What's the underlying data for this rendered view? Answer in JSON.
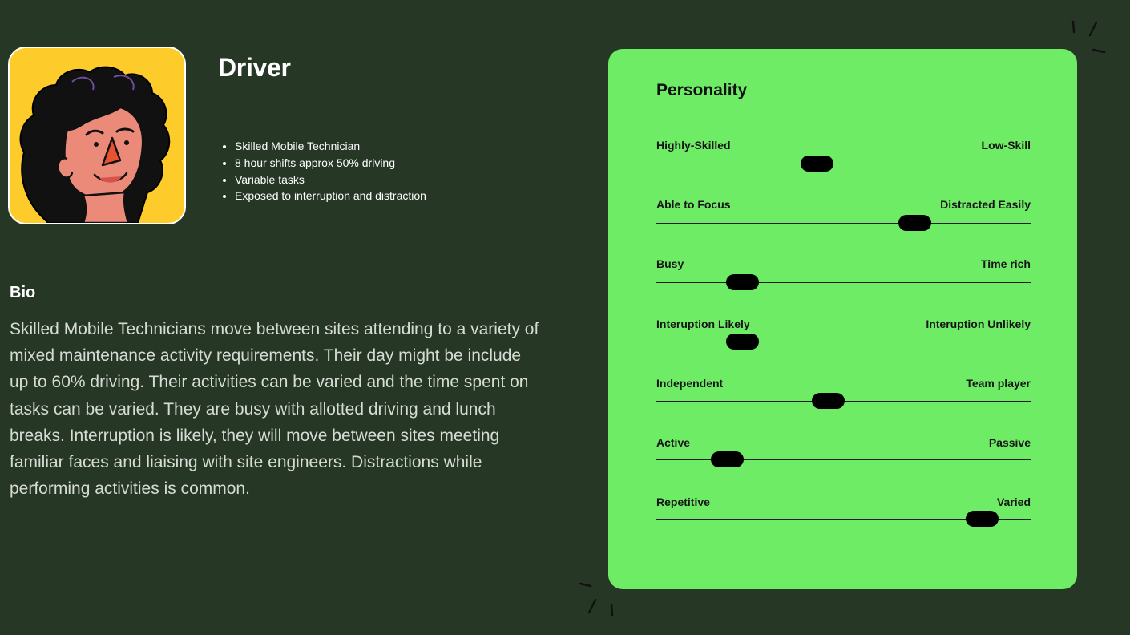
{
  "persona": {
    "title": "Driver",
    "facts": [
      "Skilled Mobile Technician",
      "8 hour shifts approx 50% driving",
      "Variable tasks",
      "Exposed to interruption and distraction"
    ],
    "avatar_icon": "illustrated-face-avatar"
  },
  "bio": {
    "heading": "Bio",
    "text": "Skilled Mobile Technicians move between sites attending to a variety of mixed maintenance activity requirements. Their day might be include up to 60% driving. Their activities can be varied and the time spent on tasks can be varied. They are busy with allotted driving and lunch breaks. Interruption is likely, they will move between sites meeting familiar faces and liaising with site engineers. Distractions while performing activities is common."
  },
  "personality": {
    "title": "Personality",
    "traits": [
      {
        "left": "Highly-Skilled",
        "right": "Low-Skill",
        "value": 0.43
      },
      {
        "left": "Able to Focus",
        "right": "Distracted Easily",
        "value": 0.69
      },
      {
        "left": "Busy",
        "right": "Time rich",
        "value": 0.23
      },
      {
        "left": "Interuption Likely",
        "right": "Interuption Unlikely",
        "value": 0.23
      },
      {
        "left": "Independent",
        "right": "Team player",
        "value": 0.46
      },
      {
        "left": "Active",
        "right": "Passive",
        "value": 0.19
      },
      {
        "left": "Repetitive",
        "right": "Varied",
        "value": 0.87
      }
    ]
  },
  "colors": {
    "background": "#263726",
    "panel": "#6fec66",
    "avatar_bg": "#fdcb2a",
    "divider": "#9a8a3a"
  }
}
